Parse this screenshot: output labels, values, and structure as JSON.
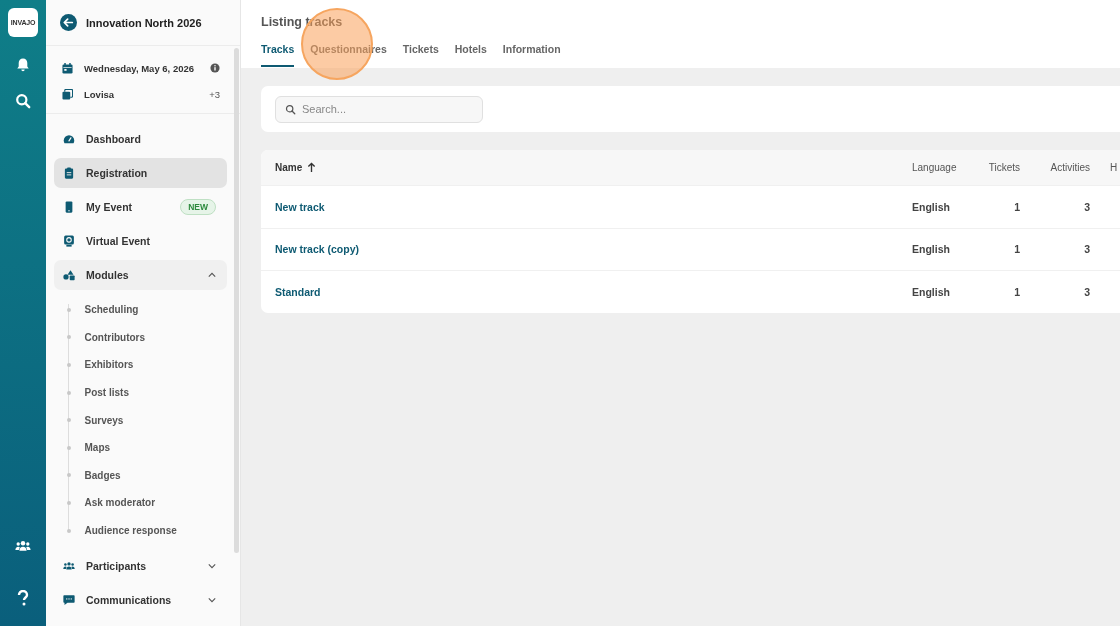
{
  "logo": {
    "text": "INVAJO"
  },
  "rail": {
    "icons": [
      {
        "kind": "bell"
      },
      {
        "kind": "search"
      },
      {
        "kind": "people"
      },
      {
        "kind": "help"
      }
    ]
  },
  "sidebar": {
    "title": "Innovation North 2026",
    "event_date": "Wednesday, May 6, 2026",
    "venue": {
      "name": "Lovisa",
      "extra": "+3"
    },
    "items": [
      {
        "label": "Dashboard",
        "kind": "gauge",
        "selected": false
      },
      {
        "label": "Registration",
        "kind": "clipboard",
        "selected": true
      },
      {
        "label": "My Event",
        "kind": "phone",
        "selected": false,
        "badge": "NEW"
      },
      {
        "label": "Virtual Event",
        "kind": "screen",
        "selected": false
      },
      {
        "label": "Modules",
        "kind": "shapes",
        "selected": false,
        "expanded": true,
        "children": [
          {
            "label": "Scheduling"
          },
          {
            "label": "Contributors"
          },
          {
            "label": "Exhibitors"
          },
          {
            "label": "Post lists"
          },
          {
            "label": "Surveys"
          },
          {
            "label": "Maps"
          },
          {
            "label": "Badges"
          },
          {
            "label": "Ask moderator"
          },
          {
            "label": "Audience response"
          }
        ]
      },
      {
        "label": "Participants",
        "kind": "people",
        "selected": false,
        "expanded": false
      },
      {
        "label": "Communications",
        "kind": "chat",
        "selected": false,
        "expanded": false
      }
    ]
  },
  "page": {
    "title": "Listing tracks",
    "tabs": [
      {
        "label": "Tracks",
        "selected": true
      },
      {
        "label": "Questionnaires",
        "selected": false
      },
      {
        "label": "Tickets",
        "selected": false
      },
      {
        "label": "Hotels",
        "selected": false
      },
      {
        "label": "Information",
        "selected": false
      }
    ],
    "search": {
      "placeholder": "Search..."
    },
    "table": {
      "columns": [
        {
          "label": "Name",
          "sorted": true
        },
        {
          "label": "Language"
        },
        {
          "label": "Tickets"
        },
        {
          "label": "Activities"
        },
        {
          "label": "H"
        }
      ],
      "rows": [
        {
          "name": "New track",
          "language": "English",
          "tickets": "1",
          "activities": "3"
        },
        {
          "name": "New track (copy)",
          "language": "English",
          "tickets": "1",
          "activities": "3"
        },
        {
          "name": "Standard",
          "language": "English",
          "tickets": "1",
          "activities": "3"
        }
      ]
    }
  },
  "click_highlight": {
    "visible": true
  }
}
